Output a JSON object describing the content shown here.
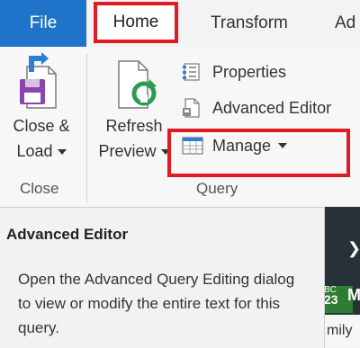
{
  "tabs": {
    "file": "File",
    "home": "Home",
    "transform": "Transform",
    "add": "Ad"
  },
  "ribbon": {
    "close_group": {
      "button_line1": "Close &",
      "button_line2": "Load",
      "group_label": "Close"
    },
    "query_group": {
      "refresh_line1": "Refresh",
      "refresh_line2": "Preview",
      "properties": "Properties",
      "advanced_editor": "Advanced Editor",
      "manage": "Manage",
      "group_label": "Query"
    }
  },
  "tooltip": {
    "title": "Advanced Editor",
    "description": "Open the Advanced Query Editing dialog to view or modify the entire text for this query."
  },
  "background": {
    "abc_top": "BC",
    "abc_num": "23",
    "col_letter": "M",
    "cell_text": "mily"
  },
  "colors": {
    "file_tab": "#1f73c8",
    "highlight": "#e11b22"
  }
}
